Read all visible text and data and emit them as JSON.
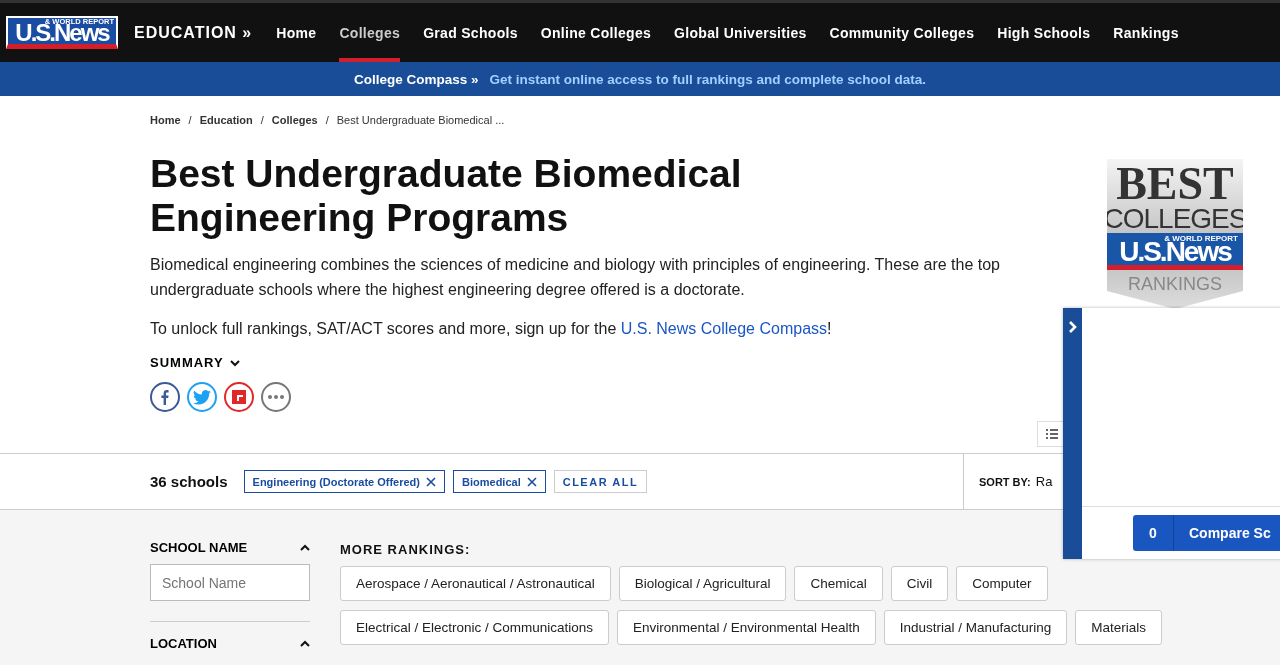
{
  "header": {
    "logo": {
      "name": "U.S.News",
      "tagline": "& WORLD REPORT"
    },
    "section": "EDUCATION »",
    "nav": [
      {
        "label": "Home",
        "selected": false
      },
      {
        "label": "Colleges",
        "selected": true
      },
      {
        "label": "Grad Schools",
        "selected": false
      },
      {
        "label": "Online Colleges",
        "selected": false
      },
      {
        "label": "Global Universities",
        "selected": false
      },
      {
        "label": "Community Colleges",
        "selected": false
      },
      {
        "label": "High Schools",
        "selected": false
      },
      {
        "label": "Rankings",
        "selected": false
      }
    ]
  },
  "promo": {
    "title": "College Compass »",
    "text": "Get instant online access to full rankings and complete school data."
  },
  "breadcrumbs": [
    "Home",
    "Education",
    "Colleges",
    "Best Undergraduate Biomedical ..."
  ],
  "breadcrumb_separator": "/",
  "title": "Best Undergraduate Biomedical Engineering Programs",
  "intro": "Biomedical engineering combines the sciences of medicine and biology with principles of engineering. These are the top undergraduate schools where the highest engineering degree offered is a doctorate.",
  "unlock": {
    "before": "To unlock full rankings, SAT/ACT scores and more, sign up for the ",
    "link": "U.S. News College Compass",
    "after": "!"
  },
  "summary": {
    "label": "SUMMARY",
    "expanded": false
  },
  "share": [
    {
      "kind": "facebook",
      "color": "#3b5998"
    },
    {
      "kind": "twitter",
      "color": "#1da1f2"
    },
    {
      "kind": "flipboard",
      "color": "#e12828"
    },
    {
      "kind": "more",
      "color": "#777777"
    }
  ],
  "badge": {
    "top": "BEST",
    "middle": "COLLEGES",
    "brand": "U.S.News",
    "tagline": "& WORLD REPORT",
    "bottom": "RANKINGS"
  },
  "filters": {
    "count": "36 schools",
    "chips": [
      "Engineering (Doctorate Offered)",
      "Biomedical"
    ],
    "clear": "CLEAR ALL",
    "sort_label": "SORT BY:",
    "sort_value": "Ra"
  },
  "sidebar": [
    {
      "label": "SCHOOL NAME",
      "expanded": true,
      "placeholder": "School Name"
    },
    {
      "label": "LOCATION",
      "expanded": true
    }
  ],
  "more_rankings": {
    "label": "MORE RANKINGS:",
    "items": [
      "Aerospace / Aeronautical / Astronautical",
      "Biological / Agricultural",
      "Chemical",
      "Civil",
      "Computer",
      "Electrical / Electronic / Communications",
      "Environmental / Environmental Health",
      "Industrial / Manufacturing",
      "Materials"
    ]
  },
  "compare": {
    "count": "0",
    "label": "Compare Sc"
  }
}
